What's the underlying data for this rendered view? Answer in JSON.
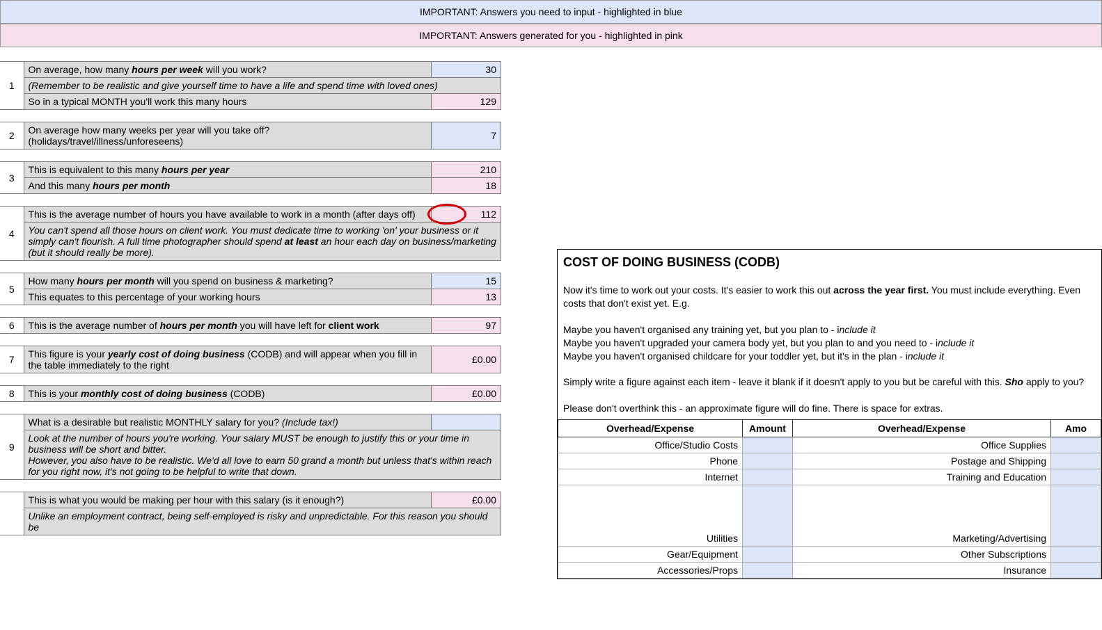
{
  "banners": {
    "blue": "IMPORTANT: Answers you need to input - highlighted in blue",
    "pink": "IMPORTANT: Answers generated for you - highlighted in pink"
  },
  "rows": {
    "r1a_pre": "On average, how many ",
    "r1a_bold": "hours per week",
    "r1a_post": " will you work?",
    "r1a_val": "30",
    "r1b": "(Remember to be realistic and give yourself time to have a life and spend time with loved ones)",
    "r1c": "So in a typical MONTH you'll work this many hours",
    "r1c_val": "129",
    "r2": "On average how many weeks per year will you take off? (holidays/travel/illness/unforeseens)",
    "r2_val": "7",
    "r3a_pre": "This is equivalent to this many ",
    "r3a_bold": "hours per year",
    "r3a_val": "210",
    "r3b_pre": "And this many ",
    "r3b_bold": "hours per month",
    "r3b_val": "18",
    "r4a": "This is the average number of hours you have available to work in a month (after days off)",
    "r4a_val": "112",
    "r4b_pre": "You can't spend all those hours on client work. You must dedicate time to working 'on' your business or it simply can't flourish. A full time photographer should spend ",
    "r4b_bold": "at least",
    "r4b_post": " an hour each day on business/marketing (but it should really be more).",
    "r5a_pre": "How many ",
    "r5a_bold": "hours per month",
    "r5a_post": " will you spend on business & marketing?",
    "r5a_val": "15",
    "r5b": "This equates to this percentage of your working hours",
    "r5b_val": "13",
    "r6_pre": "This is the average number of ",
    "r6_bold": "hours per month",
    "r6_mid": " you will have left for ",
    "r6_bold2": "client work",
    "r6_val": "97",
    "r7_pre": "This figure is your ",
    "r7_bold": "yearly cost of doing business",
    "r7_post": " (CODB) and will appear when you fill in the table immediately to the right",
    "r7_val": "£0.00",
    "r8_pre": "This is your ",
    "r8_bold": "monthly cost of doing business",
    "r8_post": " (CODB)",
    "r8_val": "£0.00",
    "r9a_pre": "What is a desirable but realistic MONTHLY salary for you? ",
    "r9a_ital": "(Include tax!)",
    "r9b": "Look at the number of hours you're working. Your salary MUST be enough to justify this or your time in business will be short and bitter.\nHowever, you also have to be realistic. We'd all love to earn 50 grand a month but unless that's within reach for you right now, it's not going to be helpful to write that down.",
    "r10a": "This is what you would be making per hour with this salary (is it enough?)",
    "r10a_val": "£0.00",
    "r10b": "Unlike an employment contract, being self-employed is risky and unpredictable. For this reason you should be"
  },
  "nums": {
    "n1": "1",
    "n2": "2",
    "n3": "3",
    "n4": "4",
    "n5": "5",
    "n6": "6",
    "n7": "7",
    "n8": "8",
    "n9": "9"
  },
  "codb": {
    "title": "COST OF DOING BUSINESS (CODB)",
    "p1a": "Now it's time to work out your costs. It's easier to work this out ",
    "p1b": "across the year first.",
    "p1c": " You must include everything. Even costs that don't exist yet. E.g.",
    "p2a": "Maybe you haven't organised any training yet, but you plan to - i",
    "p2a_i": "nclude it",
    "p2b": "Maybe you haven't upgraded your camera body yet, but you plan to and you need to - i",
    "p2b_i": "nclude it",
    "p2c": "Maybe you haven't organised childcare for your toddler yet, but it's in the plan - i",
    "p2c_i": "nclude it",
    "p3a": "Simply write a figure against each item - leave it blank if it doesn't apply to you but be careful with this. ",
    "p3b": "Sho",
    "p3c": " apply to you?",
    "p4": "Please don't overthink this - an approximate figure will do fine. There is space for extras.",
    "h1": "Overhead/Expense",
    "h2": "Amount",
    "h3": "Overhead/Expense",
    "h4": "Amo",
    "e": {
      "a1": "Office/Studio Costs",
      "b1": "Office Supplies",
      "a2": "Phone",
      "b2": "Postage and Shipping",
      "a3": "Internet",
      "b3": "Training and Education",
      "a4": "Utilities",
      "b4": "Marketing/Advertising",
      "a5": "Gear/Equipment",
      "b5": "Other Subscriptions",
      "a6": "Accessories/Props",
      "b6": "Insurance"
    }
  }
}
